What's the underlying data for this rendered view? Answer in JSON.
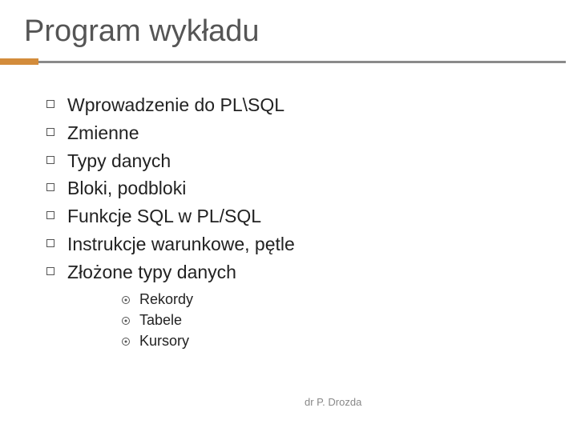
{
  "title": "Program wykładu",
  "items": [
    "Wprowadzenie do PL\\SQL",
    "Zmienne",
    "Typy danych",
    "Bloki, podbloki",
    "Funkcje SQL w PL/SQL",
    "Instrukcje warunkowe, pętle",
    "Złożone typy danych"
  ],
  "subitems": [
    "Rekordy",
    "Tabele",
    "Kursory"
  ],
  "footer": "dr P. Drozda"
}
